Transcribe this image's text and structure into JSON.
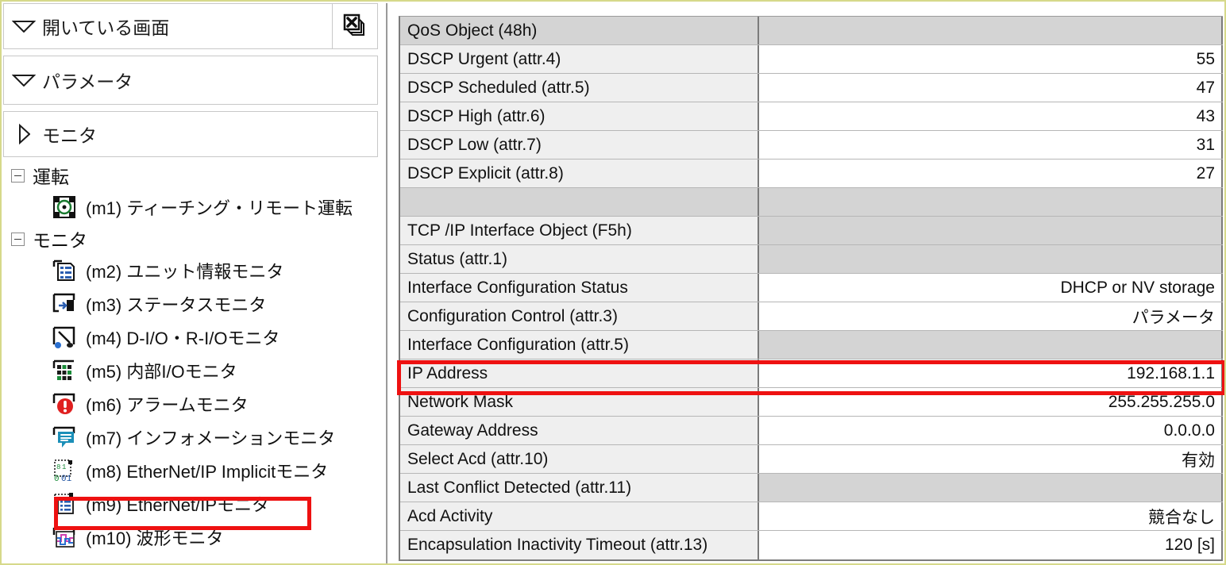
{
  "left_panel": {
    "bars": [
      {
        "id": "open-screens",
        "label": "開いている画面",
        "arrow": "down-triangle-icon",
        "expanded": true
      },
      {
        "id": "parameters",
        "label": "パラメータ",
        "arrow": "down-triangle-icon",
        "expanded": true
      },
      {
        "id": "monitor",
        "label": "モニタ",
        "arrow": "right-triangle-icon",
        "expanded": false
      }
    ],
    "close_all_button": {
      "icon": "close-all-windows-icon",
      "tooltip": ""
    },
    "tree": [
      {
        "type": "group",
        "label": "運転",
        "expander": "minus-box-icon",
        "children": [
          {
            "code": "(m1)",
            "label": "(m1) ティーチング・リモート運転",
            "icon": "teaching-remote-operation-icon",
            "selected": false
          }
        ]
      },
      {
        "type": "group",
        "label": "モニタ",
        "expander": "minus-box-icon",
        "children": [
          {
            "code": "(m2)",
            "label": "(m2) ユニット情報モニタ",
            "icon": "unit-info-monitor-icon",
            "selected": false
          },
          {
            "code": "(m3)",
            "label": "(m3) ステータスモニタ",
            "icon": "status-monitor-icon",
            "selected": false
          },
          {
            "code": "(m4)",
            "label": "(m4) D-I/O・R-I/Oモニタ",
            "icon": "dio-rio-monitor-icon",
            "selected": false
          },
          {
            "code": "(m5)",
            "label": "(m5) 内部I/Oモニタ",
            "icon": "internal-io-monitor-icon",
            "selected": false
          },
          {
            "code": "(m6)",
            "label": "(m6) アラームモニタ",
            "icon": "alarm-monitor-icon",
            "selected": false
          },
          {
            "code": "(m7)",
            "label": "(m7) インフォメーションモニタ",
            "icon": "information-monitor-icon",
            "selected": false
          },
          {
            "code": "(m8)",
            "label": "(m8) EtherNet/IP Implicitモニタ",
            "icon": "ethernetip-implicit-monitor-icon",
            "selected": false
          },
          {
            "code": "(m9)",
            "label": "(m9) EtherNet/IPモニタ",
            "icon": "ethernetip-monitor-icon",
            "selected": true
          },
          {
            "code": "(m10)",
            "label": "(m10) 波形モニタ",
            "icon": "waveform-monitor-icon",
            "selected": false
          }
        ]
      }
    ]
  },
  "table": {
    "rows": [
      {
        "name": "QoS Object (48h)",
        "value": "",
        "name_dim": true,
        "value_dim": true
      },
      {
        "name": "DSCP Urgent (attr.4)",
        "value": "55",
        "name_dim": false,
        "value_dim": false
      },
      {
        "name": "DSCP Scheduled (attr.5)",
        "value": "47",
        "name_dim": false,
        "value_dim": false
      },
      {
        "name": "DSCP High (attr.6)",
        "value": "43",
        "name_dim": false,
        "value_dim": false
      },
      {
        "name": "DSCP Low (attr.7)",
        "value": "31",
        "name_dim": false,
        "value_dim": false
      },
      {
        "name": "DSCP Explicit (attr.8)",
        "value": "27",
        "name_dim": false,
        "value_dim": false
      },
      {
        "name": "",
        "value": "",
        "name_dim": true,
        "value_dim": true
      },
      {
        "name": "TCP /IP Interface Object (F5h)",
        "value": "",
        "name_dim": false,
        "value_dim": true
      },
      {
        "name": "Status (attr.1)",
        "value": "",
        "name_dim": false,
        "value_dim": true
      },
      {
        "name": "Interface Configuration Status",
        "value": "DHCP or NV storage",
        "name_dim": false,
        "value_dim": false
      },
      {
        "name": "Configuration Control (attr.3)",
        "value": "パラメータ",
        "name_dim": false,
        "value_dim": false
      },
      {
        "name": "Interface Configuration (attr.5)",
        "value": "",
        "name_dim": false,
        "value_dim": true
      },
      {
        "name": "IP Address",
        "value": "192.168.1.1",
        "name_dim": false,
        "value_dim": false
      },
      {
        "name": "Network Mask",
        "value": "255.255.255.0",
        "name_dim": false,
        "value_dim": false
      },
      {
        "name": "Gateway Address",
        "value": "0.0.0.0",
        "name_dim": false,
        "value_dim": false
      },
      {
        "name": "Select Acd (attr.10)",
        "value": "有効",
        "name_dim": false,
        "value_dim": false
      },
      {
        "name": "Last Conflict Detected (attr.11)",
        "value": "",
        "name_dim": false,
        "value_dim": true
      },
      {
        "name": "Acd Activity",
        "value": "競合なし",
        "name_dim": false,
        "value_dim": false
      },
      {
        "name": "Encapsulation Inactivity Timeout (attr.13)",
        "value": "120 [s]",
        "name_dim": false,
        "value_dim": false
      }
    ]
  },
  "highlights": {
    "tree_selected": {
      "target": "(m9) EtherNet/IPモニタ",
      "color": "#ee1111"
    },
    "table_row": {
      "target": "IP Address",
      "color": "#ee1111"
    }
  }
}
